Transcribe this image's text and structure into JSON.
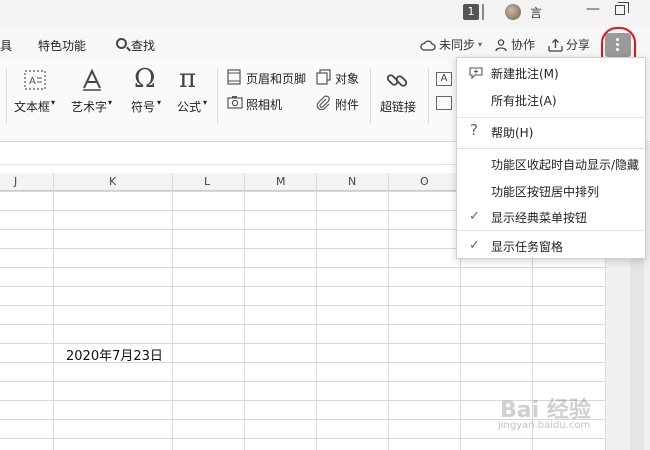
{
  "titlebar": {
    "page_count": "1",
    "user_name": "言",
    "minimize": "—"
  },
  "tabs": [
    "具",
    "特色功能",
    "查找"
  ],
  "right_buttons": {
    "sync": "未同步",
    "collab": "协作",
    "share": "分享"
  },
  "ribbon": {
    "textbox": "文本框",
    "art": "艺术字",
    "symbol": "符号",
    "formula": "公式",
    "header_footer": "页眉和页脚",
    "camera": "照相机",
    "object": "对象",
    "attachment": "附件",
    "hyperlink": "超链接"
  },
  "columns": [
    "J",
    "K",
    "L",
    "M",
    "N",
    "O"
  ],
  "cell_value": "2020年7月23日",
  "menu": {
    "items": [
      {
        "label": "新建批注(M)",
        "icon": "new-comment-icon"
      },
      {
        "label": "所有批注(A)",
        "icon": ""
      },
      {
        "label": "帮助(H)",
        "icon": "help-icon"
      },
      {
        "label": "功能区收起时自动显示/隐藏",
        "icon": ""
      },
      {
        "label": "功能区按钮居中排列",
        "icon": ""
      },
      {
        "label": "显示经典菜单按钮",
        "icon": "check-icon"
      },
      {
        "label": "显示任务窗格",
        "icon": "check-icon"
      }
    ]
  },
  "watermark": {
    "main": "Bai 经验",
    "sub": "jingyan.baidu.com"
  }
}
